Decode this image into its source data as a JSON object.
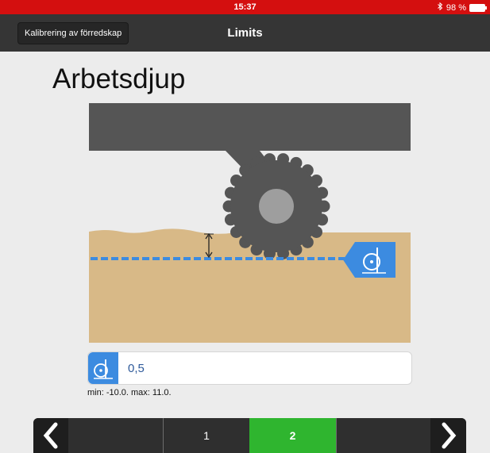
{
  "status_bar": {
    "time": "15:37",
    "battery": "98 %",
    "bluetooth_icon": "bluetooth-icon",
    "battery_icon": "battery-icon"
  },
  "nav": {
    "back_label": "Kalibrering av förredskap",
    "title": "Limits"
  },
  "page": {
    "heading": "Arbetsdjup"
  },
  "illustration": {
    "icon": "depth-wheel-icon",
    "colors": {
      "frame": "#555555",
      "soil": "#d8b987",
      "marker": "#3c8be0",
      "disc": "#9e9e9e"
    }
  },
  "field": {
    "value": "0,5",
    "icon": "depth-wheel-icon",
    "range": "min: -10.0. max: 11.0."
  },
  "pager": {
    "prev_icon": "chevron-left-icon",
    "next_icon": "chevron-right-icon",
    "pages": [
      "1",
      "2"
    ],
    "active_page": "2",
    "accent": "#2fb52f"
  }
}
